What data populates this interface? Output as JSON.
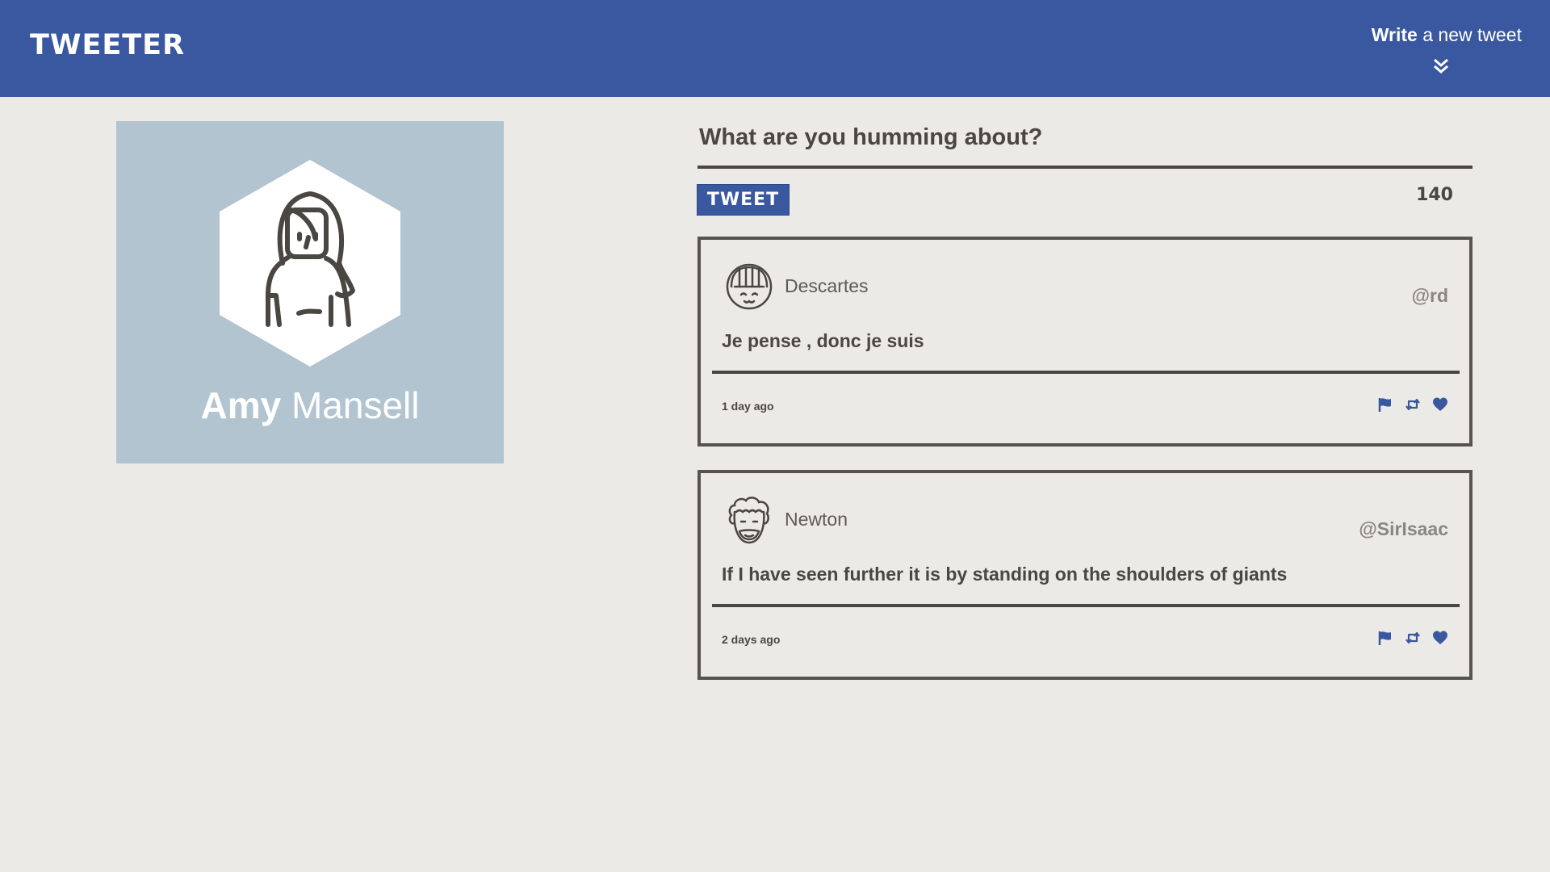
{
  "nav": {
    "logo": "TWEETER",
    "compose_bold": "Write",
    "compose_rest": " a new tweet",
    "chevron_icon": "double-chevron-down-icon"
  },
  "profile": {
    "first_name": "Amy",
    "last_name": " Mansell",
    "avatar_icon": "woman-avatar-icon",
    "card_color": "#B2C4D0"
  },
  "composer": {
    "prompt": "What are you humming about?",
    "button_label": "TWEET",
    "counter": "140"
  },
  "tweets": [
    {
      "author": "Descartes",
      "handle": "@rd",
      "text": "Je pense , donc je suis",
      "time": "1 day ago",
      "avatar_icon": "girl-face-avatar-icon"
    },
    {
      "author": "Newton",
      "handle": "@SirIsaac",
      "text": "If I have seen further it is by standing on the shoulders of giants",
      "time": "2 days ago",
      "avatar_icon": "curly-hair-face-avatar-icon"
    }
  ],
  "actions": [
    "flag-icon",
    "retweet-icon",
    "heart-icon"
  ],
  "colors": {
    "brand": "#3A58A0",
    "background": "#ECEAE7",
    "text": "#4A4641"
  }
}
